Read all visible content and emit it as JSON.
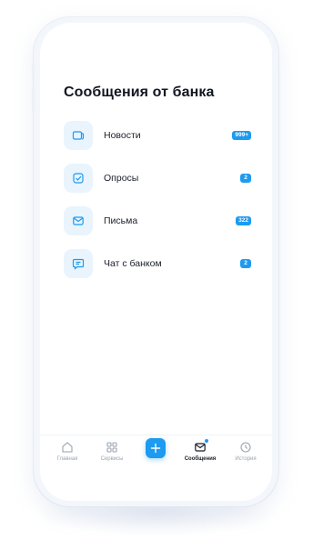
{
  "title": "Сообщения от банка",
  "accent": "#1c9bf0",
  "items": [
    {
      "label": "Новости",
      "badge": "999+",
      "icon": "news-icon"
    },
    {
      "label": "Опросы",
      "badge": "2",
      "icon": "survey-icon"
    },
    {
      "label": "Письма",
      "badge": "322",
      "icon": "mail-icon"
    },
    {
      "label": "Чат с банком",
      "badge": "2",
      "icon": "chat-icon"
    }
  ],
  "tabs": [
    {
      "label": "Главная",
      "icon": "home-icon"
    },
    {
      "label": "Сервисы",
      "icon": "grid-icon"
    },
    {
      "label": "",
      "icon": "plus-icon"
    },
    {
      "label": "Сообщения",
      "icon": "messages-icon",
      "active": true
    },
    {
      "label": "История",
      "icon": "history-icon"
    }
  ]
}
